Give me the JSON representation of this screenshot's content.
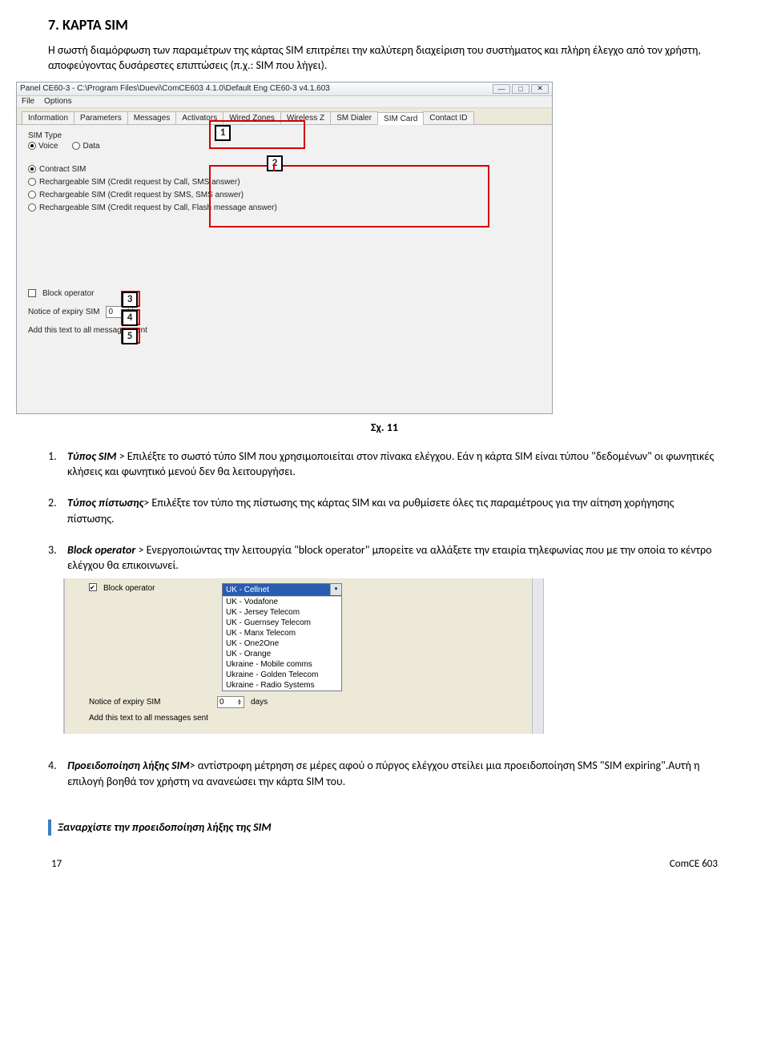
{
  "section": {
    "title": "7. ΚΑΡΤΑ SIM",
    "intro": "Η σωστή διαμόρφωση των παραμέτρων της κάρτας SIM επιτρέπει την καλύτερη διαχείριση του συστήματος και πλήρη έλεγχο από τον χρήστη, αποφεύγοντας δυσάρεστες επιπτώσεις (π.χ.: SIM που λήγει)."
  },
  "screenshot1": {
    "titlebar": "Panel CE60-3 - C:\\Program Files\\Duevi\\ComCE603 4.1.0\\Default Eng CE60-3 v4.1.603",
    "menu": {
      "file": "File",
      "options": "Options"
    },
    "tabs": [
      "Information",
      "Parameters",
      "Messages",
      "Activators",
      "Wired Zones",
      "Wireless Z",
      "SM Dialer",
      "SIM Card",
      "Contact ID"
    ],
    "active_tab_index": 7,
    "sim_type_label": "SIM Type",
    "sim_type": {
      "voice": "Voice",
      "data": "Data",
      "selected": "voice"
    },
    "contract_options": {
      "contract": "Contract SIM",
      "rech_call": "Rechargeable SIM (Credit request by Call, SMS answer)",
      "rech_sms": "Rechargeable SIM (Credit request by SMS, SMS answer)",
      "rech_flash": "Rechargeable SIM (Credit request by Call, Flash message answer)",
      "selected": "contract"
    },
    "block_operator_label": "Block operator",
    "notice_label": "Notice of expiry SIM",
    "notice_value": "0",
    "add_text_label": "Add this text to all messages sent",
    "callouts": {
      "n1": "1",
      "n2": "2",
      "n3": "3",
      "n4": "4",
      "n5": "5"
    }
  },
  "figure_caption": "Σχ. 11",
  "items": {
    "i1": {
      "num": "1.",
      "title": "Τύπος SIM",
      "sep": " > ",
      "text": "Επιλέξτε το σωστό τύπο SIM που χρησιμοποιείται στον πίνακα ελέγχου. Εάν η κάρτα SIM είναι τύπου \"δεδομένων\" οι φωνητικές κλήσεις και φωνητικό μενού δεν θα λειτουργήσει."
    },
    "i2": {
      "num": "2.",
      "title": "Τύπος πίστωσης",
      "sep": "> ",
      "text": "Επιλέξτε τον τύπο της πίστωσης της κάρτας SIM και να ρυθμίσετε όλες τις παραμέτρους για την αίτηση χορήγησης πίστωσης."
    },
    "i3": {
      "num": "3.",
      "title": "Block operator",
      "sep": " > ",
      "text": "Ενεργοποιώντας την λειτουργία \"block operator\" μπορείτε να αλλάξετε την εταιρία τηλεφωνίας που με την οποία το κέντρο ελέγχου θα επικοινωνεί."
    },
    "i4": {
      "num": "4.",
      "title": "Προειδοποίηση λήξης  SIM",
      "sep": "> ",
      "text": "αντίστροφη μέτρηση σε μέρες αφού ο πύργος ελέγχου στείλει μια προειδοποίηση SMS  \"SIM expiring\".Αυτή η επιλογή βοηθά τον χρήστη να ανανεώσει την κάρτα SIM του."
    }
  },
  "screenshot2": {
    "block_operator_label": "Block operator",
    "block_operator_checked": true,
    "notice_label": "Notice of expiry SIM",
    "notice_value": "0",
    "notice_unit": "days",
    "add_text_label": "Add this text to all messages sent",
    "dropdown": {
      "selected": "UK - Cellnet",
      "options": [
        "UK - Vodafone",
        "UK - Jersey Telecom",
        "UK - Guernsey Telecom",
        "UK - Manx Telecom",
        "UK - One2One",
        "UK - Orange",
        "Ukraine - Mobile comms",
        "Ukraine - Golden Telecom",
        "Ukraine - Radio Systems"
      ]
    }
  },
  "restart_heading": "Ξαναρχίστε την προειδοποίηση λήξης της SIM",
  "footer": {
    "page": "17",
    "doc": "ComCE 603"
  }
}
